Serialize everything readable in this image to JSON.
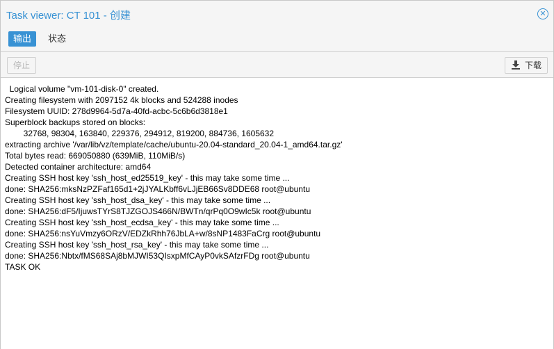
{
  "window": {
    "title": "Task viewer: CT 101 - 创建"
  },
  "tabs": [
    {
      "label": "输出",
      "active": true
    },
    {
      "label": "状态",
      "active": false
    }
  ],
  "toolbar": {
    "stop_label": "停止",
    "download_label": "下载"
  },
  "log_lines": [
    "  Logical volume \"vm-101-disk-0\" created.",
    "Creating filesystem with 2097152 4k blocks and 524288 inodes",
    "Filesystem UUID: 278d9964-5d7a-40fd-acbc-5c6b6d3818e1",
    "Superblock backups stored on blocks:",
    "        32768, 98304, 163840, 229376, 294912, 819200, 884736, 1605632",
    "extracting archive '/var/lib/vz/template/cache/ubuntu-20.04-standard_20.04-1_amd64.tar.gz'",
    "Total bytes read: 669050880 (639MiB, 110MiB/s)",
    "Detected container architecture: amd64",
    "Creating SSH host key 'ssh_host_ed25519_key' - this may take some time ...",
    "done: SHA256:mksNzPZFaf165d1+2jJYALKbff6vLJjEB66Sv8DDE68 root@ubuntu",
    "Creating SSH host key 'ssh_host_dsa_key' - this may take some time ...",
    "done: SHA256:dF5/IjuwsTYrS8TJZGOJS466N/BWTn/qrPq0O9wIc5k root@ubuntu",
    "Creating SSH host key 'ssh_host_ecdsa_key' - this may take some time ...",
    "done: SHA256:nsYuVmzy6ORzV/EDZkRhh76JbLA+w/8sNP1483FaCrg root@ubuntu",
    "Creating SSH host key 'ssh_host_rsa_key' - this may take some time ...",
    "done: SHA256:Nbtx/fMS68SAj8bMJWI53QIsxpMfCAyP0vkSAfzrFDg root@ubuntu",
    "TASK OK"
  ],
  "colors": {
    "accent": "#3892d4",
    "toolbar_bg": "#f5f5f5",
    "text": "#000000"
  },
  "icons": {
    "close": "close-circle-icon",
    "download": "download-icon"
  }
}
